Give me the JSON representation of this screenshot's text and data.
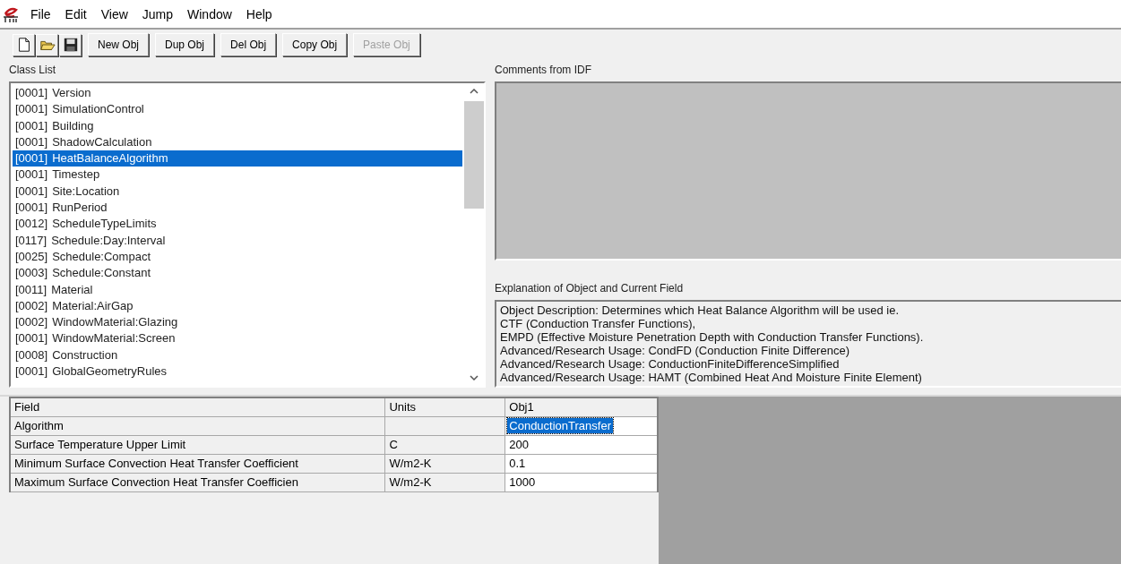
{
  "menu": [
    "File",
    "Edit",
    "View",
    "Jump",
    "Window",
    "Help"
  ],
  "toolbar": {
    "icons": [
      {
        "kind": "new"
      },
      {
        "kind": "open"
      },
      {
        "kind": "save"
      }
    ],
    "buttons": [
      {
        "label": "New Obj",
        "disabled": false
      },
      {
        "label": "Dup Obj",
        "disabled": false
      },
      {
        "label": "Del Obj",
        "disabled": false
      },
      {
        "label": "Copy Obj",
        "disabled": false
      },
      {
        "label": "Paste Obj",
        "disabled": true
      }
    ]
  },
  "class_list": {
    "label": "Class List",
    "items": [
      {
        "count": "[0001]",
        "name": "Version",
        "selected": false
      },
      {
        "count": "[0001]",
        "name": "SimulationControl",
        "selected": false
      },
      {
        "count": "[0001]",
        "name": "Building",
        "selected": false
      },
      {
        "count": "[0001]",
        "name": "ShadowCalculation",
        "selected": false
      },
      {
        "count": "[0001]",
        "name": "HeatBalanceAlgorithm",
        "selected": true
      },
      {
        "count": "[0001]",
        "name": "Timestep",
        "selected": false
      },
      {
        "count": "[0001]",
        "name": "Site:Location",
        "selected": false
      },
      {
        "count": "[0001]",
        "name": "RunPeriod",
        "selected": false
      },
      {
        "count": "[0012]",
        "name": "ScheduleTypeLimits",
        "selected": false
      },
      {
        "count": "[0117]",
        "name": "Schedule:Day:Interval",
        "selected": false
      },
      {
        "count": "[0025]",
        "name": "Schedule:Compact",
        "selected": false
      },
      {
        "count": "[0003]",
        "name": "Schedule:Constant",
        "selected": false
      },
      {
        "count": "[0011]",
        "name": "Material",
        "selected": false
      },
      {
        "count": "[0002]",
        "name": "Material:AirGap",
        "selected": false
      },
      {
        "count": "[0002]",
        "name": "WindowMaterial:Glazing",
        "selected": false
      },
      {
        "count": "[0001]",
        "name": "WindowMaterial:Screen",
        "selected": false
      },
      {
        "count": "[0008]",
        "name": "Construction",
        "selected": false
      },
      {
        "count": "[0001]",
        "name": "GlobalGeometryRules",
        "selected": false
      }
    ]
  },
  "comments": {
    "label": "Comments from IDF"
  },
  "explanation": {
    "label": "Explanation of Object and Current Field",
    "lines": [
      "Object Description: Determines which Heat Balance Algorithm will be used ie.",
      "CTF (Conduction Transfer Functions),",
      "EMPD (Effective Moisture Penetration Depth with Conduction Transfer Functions).",
      "Advanced/Research Usage: CondFD (Conduction Finite Difference)",
      "Advanced/Research Usage: ConductionFiniteDifferenceSimplified",
      "Advanced/Research Usage: HAMT (Combined Heat And Moisture Finite Element)"
    ]
  },
  "grid": {
    "columns": [
      "Field",
      "Units",
      "Obj1"
    ],
    "rows": [
      {
        "field": "Algorithm",
        "units": "",
        "value": "ConductionTransfer",
        "selected": true
      },
      {
        "field": "Surface Temperature Upper Limit",
        "units": "C",
        "value": "200",
        "selected": false
      },
      {
        "field": "Minimum Surface Convection Heat Transfer Coefficient",
        "units": "W/m2-K",
        "value": "0.1",
        "selected": false
      },
      {
        "field": "Maximum Surface Convection Heat Transfer Coefficien",
        "units": "W/m2-K",
        "value": "1000",
        "selected": false
      }
    ]
  }
}
